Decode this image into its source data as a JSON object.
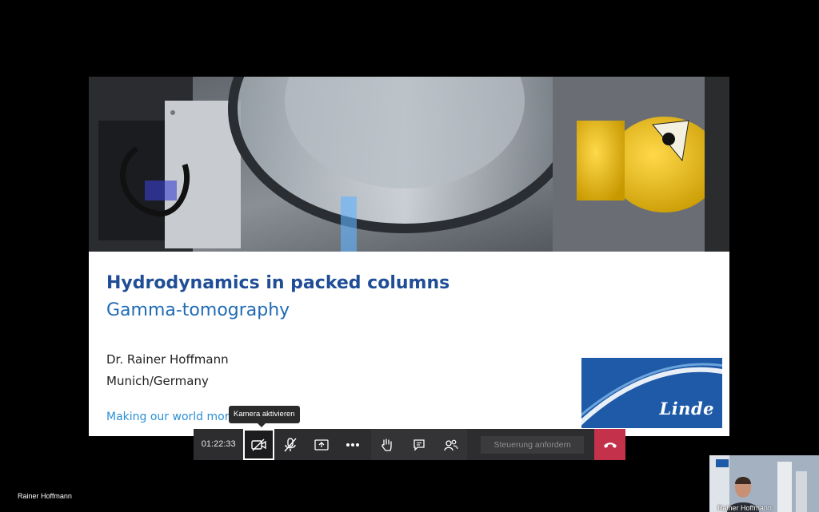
{
  "slide": {
    "title": "Hydrodynamics in packed columns",
    "subtitle": "Gamma-tomography",
    "author": "Dr. Rainer Hoffmann",
    "location": "Munich/Germany",
    "tagline": "Making our world more p",
    "logo_text": "Linde"
  },
  "tooltip": "Kamera aktivieren",
  "toolbar": {
    "duration": "01:22:33",
    "control_label": "Steuerung anfordern",
    "icons": {
      "camera": "camera-off-icon",
      "mic": "mic-off-icon",
      "share": "share-screen-icon",
      "more": "more-icon",
      "hand": "raise-hand-icon",
      "chat": "chat-icon",
      "participants": "participants-icon",
      "hangup": "hang-up-icon"
    },
    "hangup_color": "#c4314b"
  },
  "presenter_name": "Rainer Hoffmann",
  "self_view_name": "Rainer Hoffmann"
}
